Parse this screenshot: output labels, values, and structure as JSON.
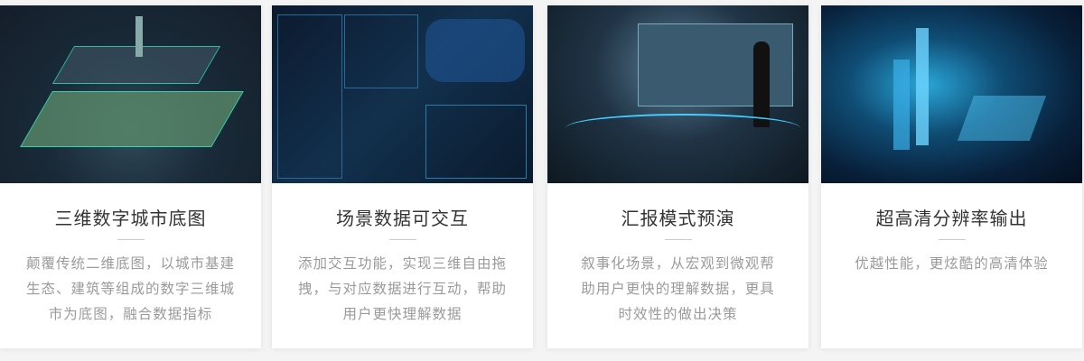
{
  "cards": [
    {
      "title": "三维数字城市底图",
      "desc": [
        "颠覆传统二维底图，以城市基建",
        "生态、建筑等组成的数字三维城",
        "市为底图，融合数据指标"
      ]
    },
    {
      "title": "场景数据可交互",
      "desc": [
        "添加交互功能，实现三维自由拖",
        "拽，与对应数据进行互动，帮助",
        "用户更快理解数据"
      ]
    },
    {
      "title": "汇报模式预演",
      "desc": [
        "叙事化场景，从宏观到微观帮",
        "助用户更快的理解数据，更具",
        "时效性的做出决策"
      ]
    },
    {
      "title": "超高清分辨率输出",
      "desc": [
        "优越性能，更炫酷的高清体验"
      ]
    }
  ]
}
